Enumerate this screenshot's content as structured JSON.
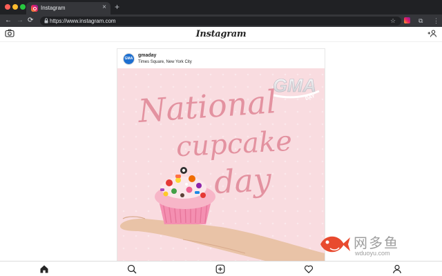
{
  "browser": {
    "tab": {
      "title": "Instagram",
      "close": "×"
    },
    "new_tab": "+",
    "nav": {
      "back": "←",
      "forward": "→",
      "reload": "⟳"
    },
    "address": {
      "lock": "🔒",
      "url": "https://www.instagram.com"
    },
    "toolbar_icons": {
      "star": "☆",
      "agent": "⧉",
      "menu": "⋮"
    }
  },
  "app": {
    "logo": "Instagram",
    "header_icons": [
      "camera-icon",
      "add-user-icon"
    ]
  },
  "post": {
    "avatar_text": "GMA",
    "username": "gmaday",
    "location": "Times Square, New York City",
    "image": {
      "badge_main": "GMA",
      "badge_sub": "DAY",
      "lines": [
        "National",
        "cupcake",
        "day"
      ],
      "colors": {
        "background": "#f9dce0",
        "script": "#e392a0",
        "liner": "#f48fb1"
      }
    }
  },
  "bottom_nav": [
    "home-icon",
    "search-icon",
    "new-post-icon",
    "activity-heart-icon",
    "profile-icon"
  ],
  "watermark": {
    "cn": "网多鱼",
    "url": "wduoyu.com",
    "color": "#e84a2f"
  }
}
